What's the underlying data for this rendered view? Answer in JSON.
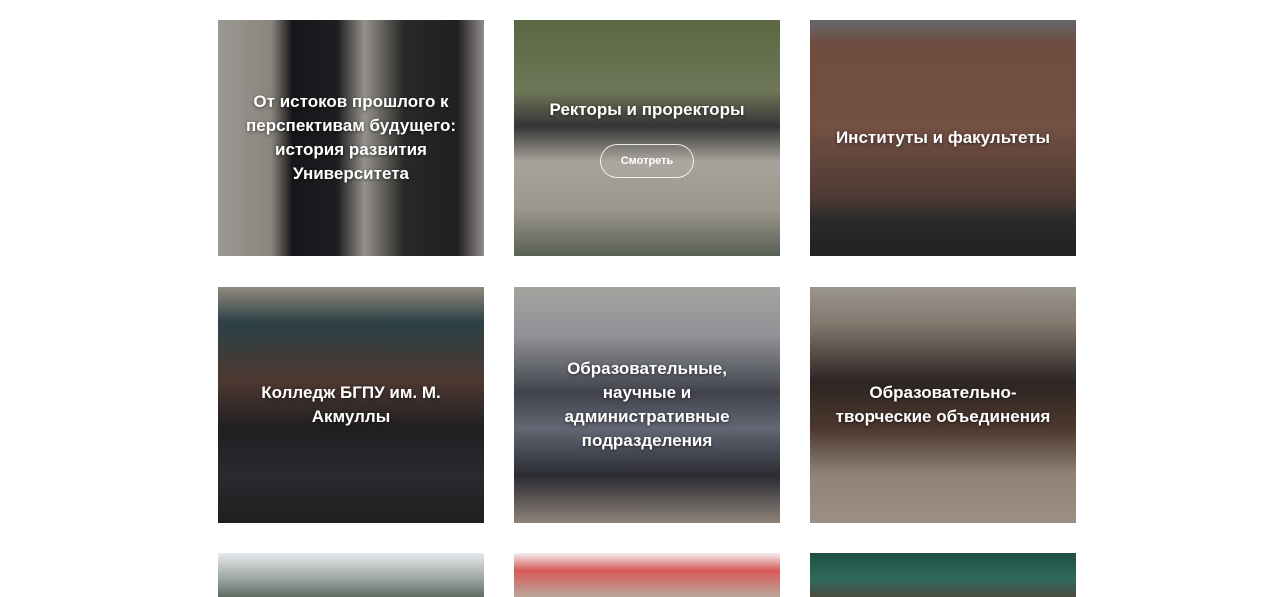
{
  "tiles": [
    {
      "title": "От истоков прошлого к перспективам будущего: история развития Университета"
    },
    {
      "title": "Ректоры и проректоры",
      "button_label": "Смотреть"
    },
    {
      "title": "Институты и факультеты"
    },
    {
      "title": "Колледж БГПУ им. М. Акмуллы"
    },
    {
      "title": "Образовательные, научные и административные подразделения"
    },
    {
      "title": "Образовательно-творческие объединения"
    },
    {
      "title": ""
    },
    {
      "title": ""
    },
    {
      "title": ""
    }
  ]
}
